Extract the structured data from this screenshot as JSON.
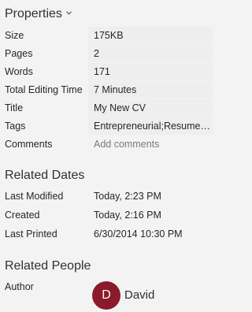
{
  "properties": {
    "title": "Properties",
    "rows": [
      {
        "label": "Size",
        "value": "175KB"
      },
      {
        "label": "Pages",
        "value": "2"
      },
      {
        "label": "Words",
        "value": "171"
      },
      {
        "label": "Total Editing Time",
        "value": "7 Minutes"
      },
      {
        "label": "Title",
        "value": "My New CV"
      },
      {
        "label": "Tags",
        "value": "Entrepreneurial;Resume;A..."
      },
      {
        "label": "Comments",
        "value": "Add comments"
      }
    ]
  },
  "related_dates": {
    "title": "Related Dates",
    "rows": [
      {
        "label": "Last Modified",
        "value": "Today, 2:23 PM"
      },
      {
        "label": "Created",
        "value": "Today, 2:16 PM"
      },
      {
        "label": "Last Printed",
        "value": "6/30/2014 10:30 PM"
      }
    ]
  },
  "related_people": {
    "title": "Related People",
    "author_label": "Author",
    "author_initial": "D",
    "author_name": "David",
    "avatar_color": "#8b1a2b"
  }
}
